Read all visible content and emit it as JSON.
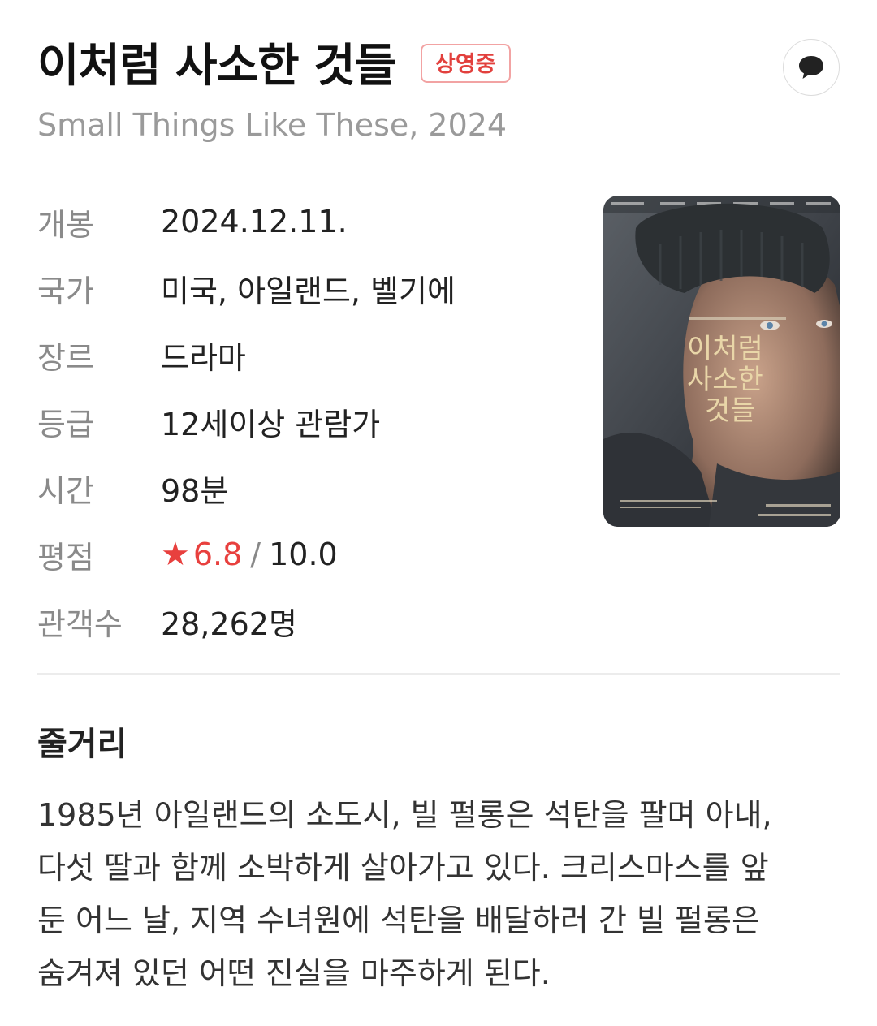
{
  "movie": {
    "title": "이처럼 사소한 것들",
    "status_badge": "상영중",
    "original_title_year": "Small Things Like These, 2024",
    "comment_icon": "speech-bubble-icon"
  },
  "info": {
    "release": {
      "label": "개봉",
      "value": "2024.12.11."
    },
    "country": {
      "label": "국가",
      "value": "미국, 아일랜드, 벨기에"
    },
    "genre": {
      "label": "장르",
      "value": "드라마"
    },
    "rating_class": {
      "label": "등급",
      "value": "12세이상 관람가"
    },
    "runtime": {
      "label": "시간",
      "value": "98분"
    },
    "score": {
      "label": "평점",
      "star": "★",
      "value": "6.8",
      "separator": "/",
      "max": "10.0"
    },
    "audience": {
      "label": "관객수",
      "value": "28,262명"
    }
  },
  "poster": {
    "title_lines": [
      "이처럼",
      "사소한",
      "것들"
    ]
  },
  "synopsis": {
    "heading": "줄거리",
    "lines": [
      "1985년 아일랜드의 소도시, 빌 펄롱은 석탄을 팔며 아내,",
      "다섯 딸과 함께 소박하게 살아가고 있다. 크리스마스를 앞",
      "둔 어느 날, 지역 수녀원에 석탄을 배달하러 간 빌 펄롱은",
      "숨겨져 있던 어떤 진실을 마주하게 된다."
    ]
  },
  "colors": {
    "accent_red": "#e8403e",
    "badge_border": "#f2a3a3",
    "label_gray": "#8a8a8a"
  }
}
